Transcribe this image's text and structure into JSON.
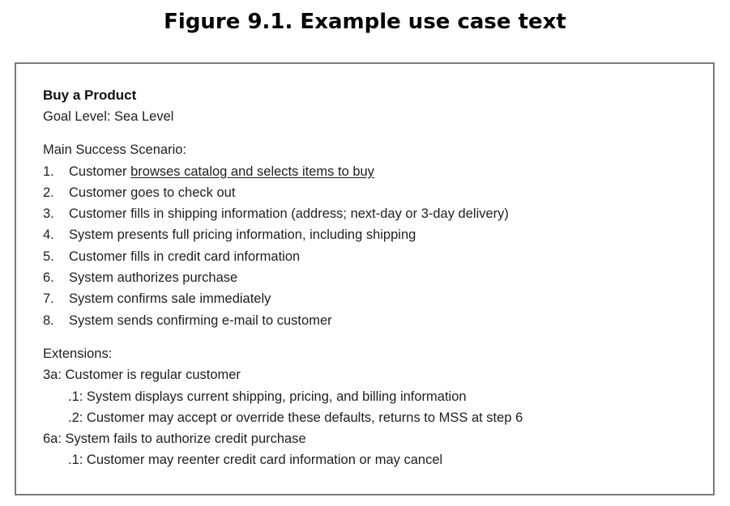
{
  "figure": {
    "title": "Figure 9.1. Example use case text"
  },
  "use_case": {
    "name": "Buy a Product",
    "goal_level": "Goal Level: Sea Level",
    "main_heading": "Main Success Scenario:",
    "steps": [
      {
        "num": "1.",
        "text": "Customer ",
        "underlined": "browses catalog and selects items to buy"
      },
      {
        "num": "2.",
        "text": "Customer goes to check out"
      },
      {
        "num": "3.",
        "text": "Customer fills in shipping information (address; next-day or 3-day delivery)"
      },
      {
        "num": "4.",
        "text": "System presents full pricing information, including shipping"
      },
      {
        "num": "5.",
        "text": "Customer fills in credit card information"
      },
      {
        "num": "6.",
        "text": "System authorizes purchase"
      },
      {
        "num": "7.",
        "text": "System confirms sale immediately"
      },
      {
        "num": "8.",
        "text": "System sends confirming e-mail to customer"
      }
    ],
    "extensions_heading": "Extensions:",
    "extensions": [
      {
        "id_text": "3a: Customer is regular customer",
        "subs": [
          ".1: System displays current shipping, pricing, and billing information",
          ".2: Customer may accept or override these defaults, returns to MSS at step 6"
        ]
      },
      {
        "id_text": "6a: System fails to authorize credit purchase",
        "subs": [
          ".1: Customer may reenter credit card information or may cancel"
        ]
      }
    ]
  }
}
